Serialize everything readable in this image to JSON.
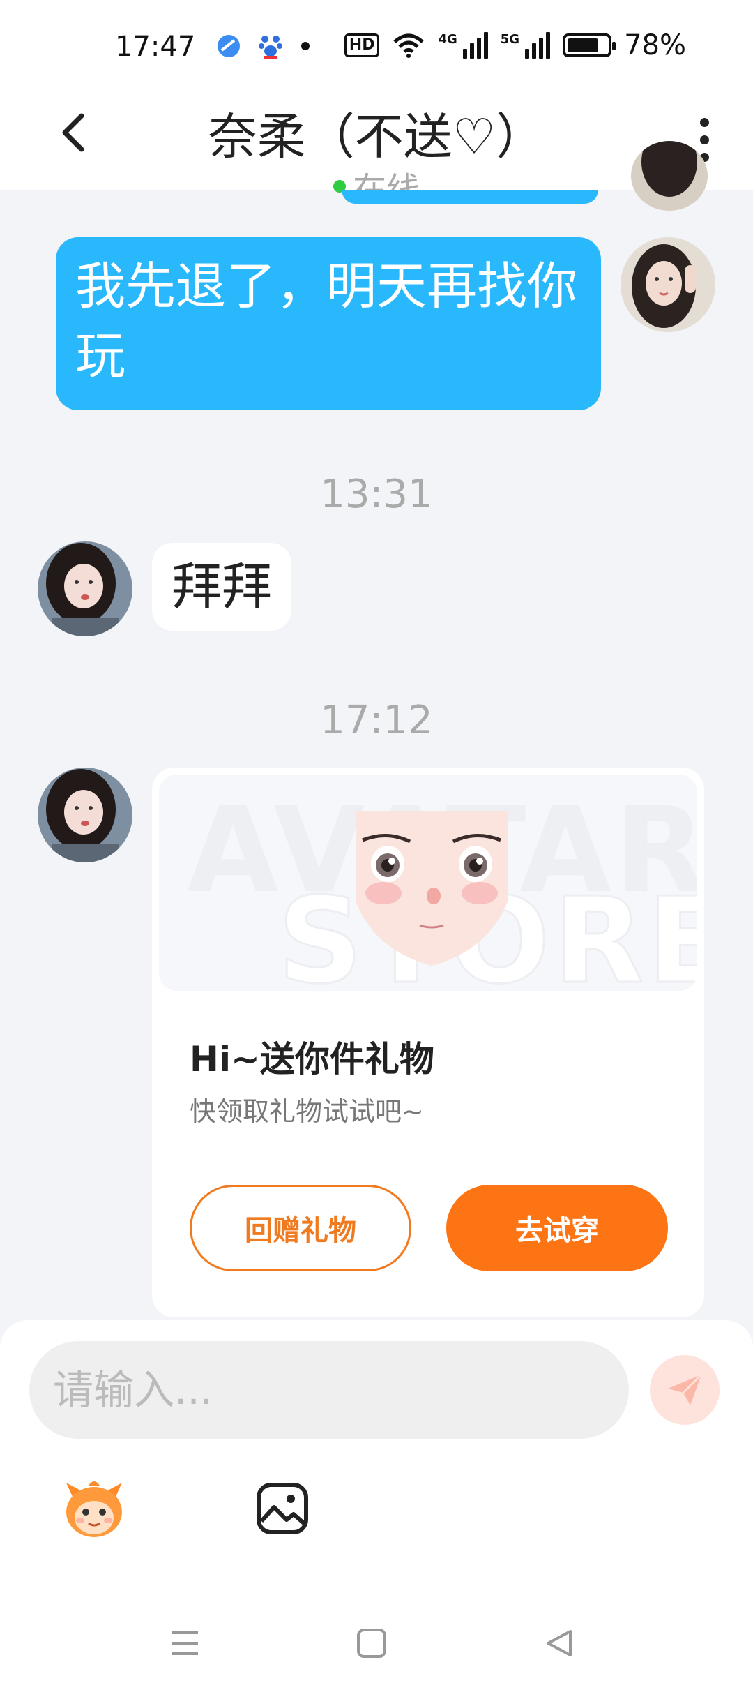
{
  "status_bar": {
    "time": "17:47",
    "hd": "HD",
    "net1": "4G",
    "net2": "5G",
    "battery": "78%",
    "battery_level": 0.78
  },
  "header": {
    "title": "奈柔（不送♡）",
    "status": "在线",
    "status_color": "#2ecc40"
  },
  "messages": {
    "outgoing_1": "我先退了，明天再找你玩",
    "time_1": "13:31",
    "incoming_1": "拜拜",
    "time_2": "17:12"
  },
  "gift_card": {
    "watermark_line1": "AVATAR",
    "watermark_line2": "STORE",
    "title": "Hi~送你件礼物",
    "subtitle": "快领取礼物试试吧~",
    "return_button": "回赠礼物",
    "try_button": "去试穿",
    "accent_color": "#fd7415"
  },
  "input": {
    "placeholder": "请输入..."
  },
  "colors": {
    "outgoing_bubble": "#29b8fb",
    "background": "#f2f4f7"
  },
  "icons": [
    "back-icon",
    "more-icon",
    "send-icon",
    "sticker-icon",
    "image-icon",
    "menu-icon",
    "home-icon",
    "back-nav-icon"
  ]
}
